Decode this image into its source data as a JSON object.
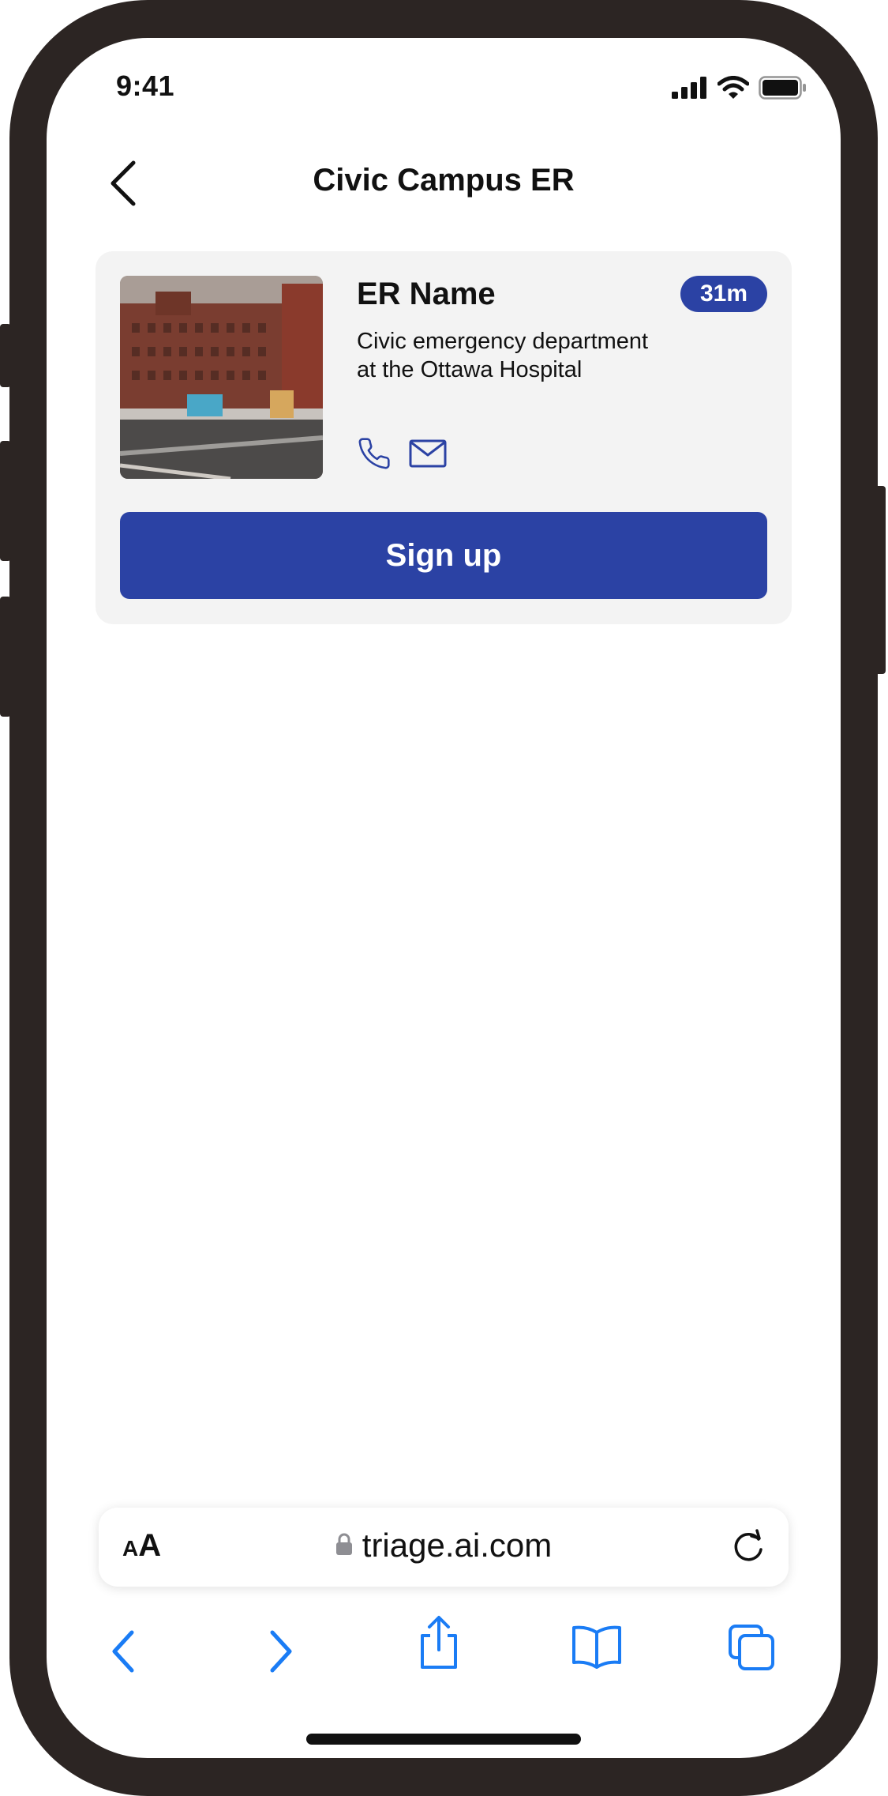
{
  "status_bar": {
    "time": "9:41",
    "icons": [
      "signal-icon",
      "wifi-icon",
      "battery-icon"
    ]
  },
  "header": {
    "title": "Civic Campus ER",
    "back_icon": "chevron-left-icon"
  },
  "er_card": {
    "name": "ER Name",
    "wait_time": "31m",
    "description_line1": "Civic emergency department",
    "description_line2": "at the Ottawa Hospital",
    "contact_icons": [
      "phone-icon",
      "mail-icon"
    ],
    "signup_label": "Sign up"
  },
  "browser": {
    "text_size_small": "A",
    "text_size_big": "A",
    "url": "triage.ai.com",
    "toolbar_icons": [
      "back-icon",
      "forward-icon",
      "share-icon",
      "bookmarks-icon",
      "tabs-icon"
    ]
  },
  "colors": {
    "accent": "#2b42a4",
    "browser_blue": "#1a7cf5",
    "frame": "#2c2523",
    "card_bg": "#f3f3f3"
  }
}
